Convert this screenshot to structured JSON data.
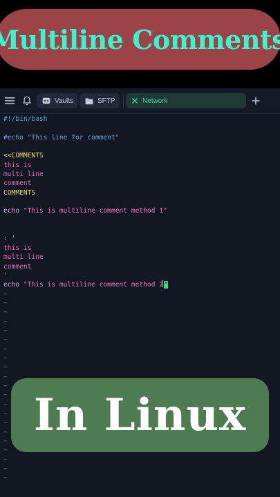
{
  "overlay": {
    "title": "Multiline Comments",
    "subtitle": "In Linux",
    "colors": {
      "title_bg": "#9b4448",
      "title_text": "#3ef2d0",
      "subtitle_bg": "#4e7b52"
    }
  },
  "toolbar": {
    "icons": [
      "menu-icon",
      "bell-icon"
    ],
    "tabs": [
      {
        "label": "Vaults",
        "icon": "vault-icon"
      },
      {
        "label": "SFTP",
        "icon": "folder-icon"
      },
      {
        "label": "Network",
        "icon": "close-icon",
        "active": true
      }
    ],
    "add_icon": "plus-icon"
  },
  "editor": {
    "lines": [
      "#!/bin/bash",
      "",
      "#echo \"This line for comment\"",
      "",
      "<<COMMENTS",
      "this is",
      "multi line",
      "comment",
      "COMMENTS",
      "",
      "echo",
      "\"This is multiline comment method 1\"",
      "",
      "",
      ": '",
      "this is",
      "multi line",
      "comment",
      "'",
      "echo",
      "\"This is multiline comment method 2",
      "\""
    ],
    "tilde": "~",
    "tilde_count": 21
  }
}
